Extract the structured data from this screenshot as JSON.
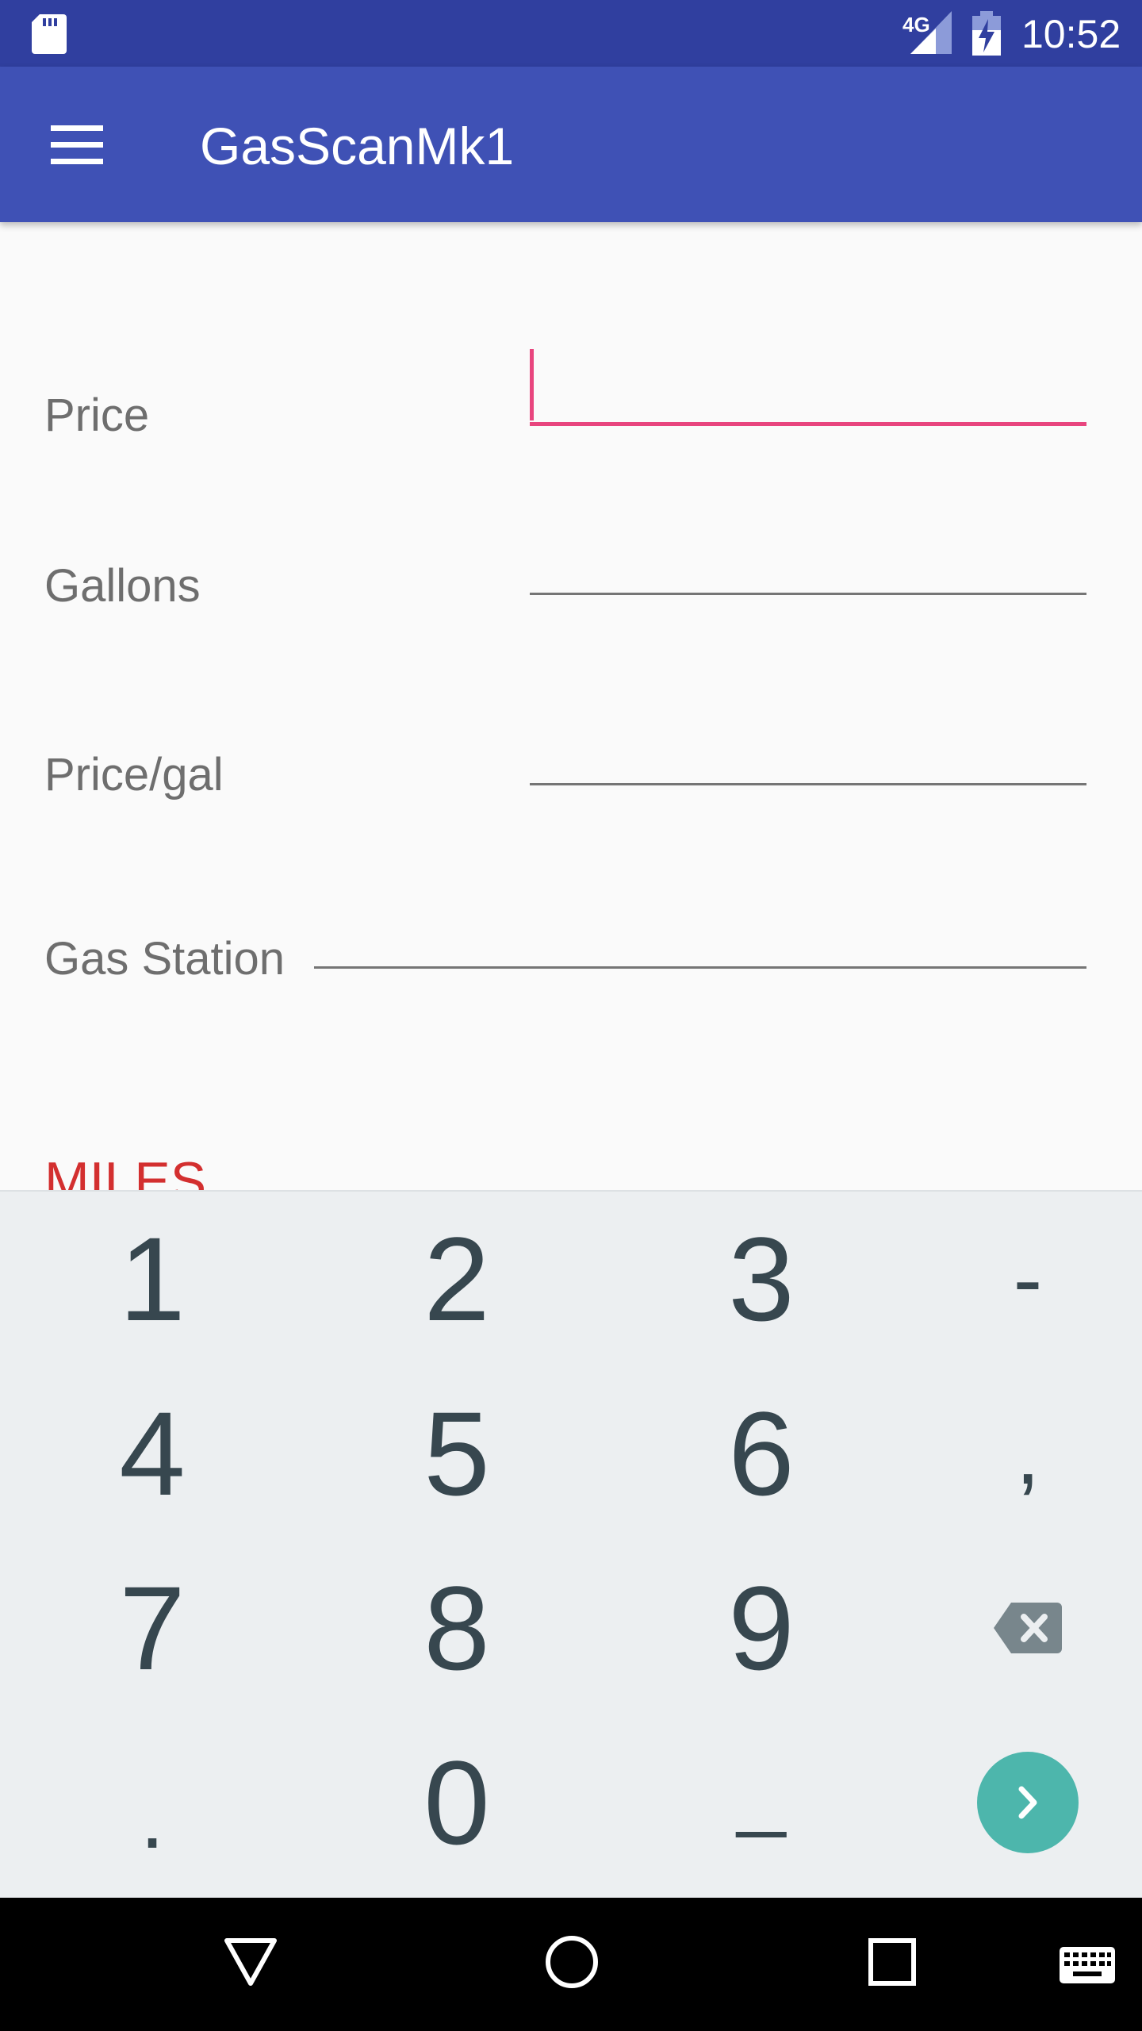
{
  "status_bar": {
    "network": "4G",
    "time": "10:52"
  },
  "app_bar": {
    "title": "GasScanMk1",
    "menu_icon": "hamburger-menu-icon"
  },
  "form": {
    "price_label": "Price",
    "gallons_label": "Gallons",
    "price_per_gal_label": "Price/gal",
    "gas_station_label": "Gas Station",
    "miles_label": "MILES",
    "price_value": "",
    "gallons_value": "",
    "price_per_gal_value": "",
    "gas_station_value": "",
    "focus_color": "#e8457e"
  },
  "keyboard": {
    "rows": [
      [
        "1",
        "2",
        "3",
        "-"
      ],
      [
        "4",
        "5",
        "6",
        ","
      ],
      [
        "7",
        "8",
        "9",
        "backspace-icon"
      ],
      [
        ".",
        "0",
        "_",
        "next-icon"
      ]
    ],
    "accent": "#4db6ac"
  },
  "nav_bar": {
    "back": "back-triangle-icon",
    "home": "home-circle-icon",
    "recents": "recents-square-icon",
    "keyboard": "keyboard-icon"
  },
  "colors": {
    "status_bar": "#303f9f",
    "app_bar": "#3f51b5",
    "miles": "#d32f2f"
  }
}
